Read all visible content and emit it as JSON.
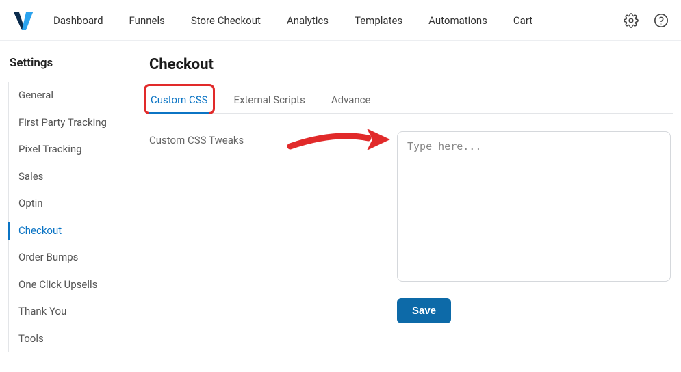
{
  "topnav": {
    "items": [
      {
        "label": "Dashboard"
      },
      {
        "label": "Funnels"
      },
      {
        "label": "Store Checkout"
      },
      {
        "label": "Analytics"
      },
      {
        "label": "Templates"
      },
      {
        "label": "Automations"
      },
      {
        "label": "Cart"
      }
    ]
  },
  "sidebar": {
    "title": "Settings",
    "items": [
      {
        "label": "General",
        "active": false
      },
      {
        "label": "First Party Tracking",
        "active": false
      },
      {
        "label": "Pixel Tracking",
        "active": false
      },
      {
        "label": "Sales",
        "active": false
      },
      {
        "label": "Optin",
        "active": false
      },
      {
        "label": "Checkout",
        "active": true
      },
      {
        "label": "Order Bumps",
        "active": false
      },
      {
        "label": "One Click Upsells",
        "active": false
      },
      {
        "label": "Thank You",
        "active": false
      },
      {
        "label": "Tools",
        "active": false
      }
    ]
  },
  "page": {
    "title": "Checkout",
    "tabs": [
      {
        "label": "Custom CSS",
        "active": true
      },
      {
        "label": "External Scripts",
        "active": false
      },
      {
        "label": "Advance",
        "active": false
      }
    ],
    "form": {
      "label": "Custom CSS Tweaks",
      "placeholder": "Type here..."
    },
    "save_label": "Save"
  }
}
